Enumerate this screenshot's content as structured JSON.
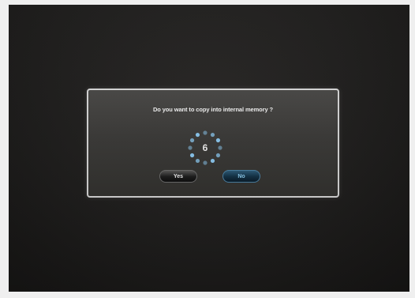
{
  "dialog": {
    "message": "Do you want to copy into internal memory ?",
    "countdown": "6",
    "yes_label": "Yes",
    "no_label": "No"
  },
  "colors": {
    "accent": "#4da6e0",
    "spinner_dot": "#8cc8f0",
    "dialog_border": "#d8d8d8",
    "screen_bg": "#1f1e1d"
  },
  "icons": {
    "spinner": "loading-spinner-icon"
  }
}
